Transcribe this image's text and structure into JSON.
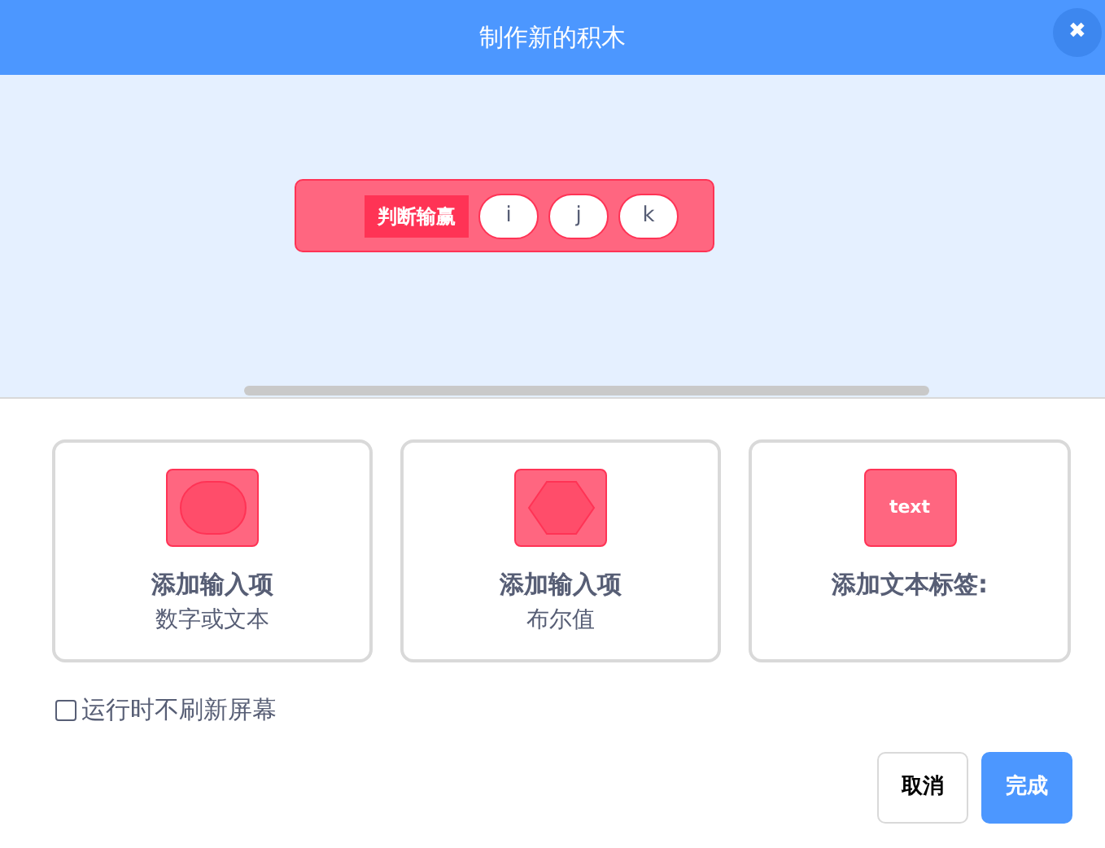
{
  "window": {
    "title": "制作新的积木",
    "close_icon": "✖"
  },
  "block": {
    "parts": [
      {
        "kind": "label",
        "text": "判断输赢"
      },
      {
        "kind": "input",
        "text": "i"
      },
      {
        "kind": "input",
        "text": "j"
      },
      {
        "kind": "input",
        "text": "k"
      }
    ]
  },
  "options": [
    {
      "kind": "round",
      "title": "添加输入项",
      "subtitle": "数字或文本"
    },
    {
      "kind": "boolean",
      "title": "添加输入项",
      "subtitle": "布尔值"
    },
    {
      "kind": "label",
      "icon_text": "text",
      "title": "添加文本标签:"
    }
  ],
  "checkbox": {
    "label": "运行时不刷新屏幕",
    "checked": false
  },
  "buttons": [
    {
      "kind": "secondary",
      "label": "取消"
    },
    {
      "kind": "primary",
      "label": "完成"
    }
  ]
}
